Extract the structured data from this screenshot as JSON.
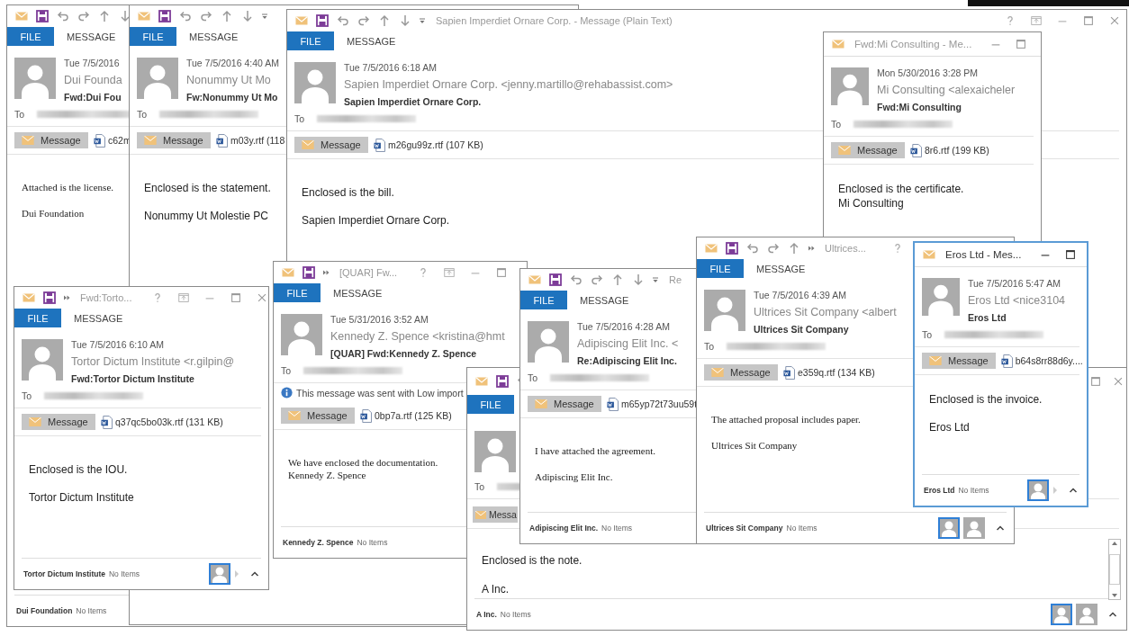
{
  "windows": [
    {
      "kind": "ribbon",
      "active": false,
      "tabs": [
        {
          "label": "FILE",
          "kind": "file"
        },
        {
          "label": "MESSAGE",
          "kind": "tab"
        }
      ],
      "date": "Tue 7/5/2016",
      "sender": "Dui Founda",
      "subject": "Fwd:Dui Fou",
      "to_label": "To",
      "message_button": "Message",
      "attachment": "c62m",
      "body": {
        "kind": "html",
        "paragraphs": [
          [
            "Attached is the license."
          ],
          [
            "Dui Foundation"
          ]
        ]
      },
      "footer": {
        "name": "Dui Foundation",
        "status": "No Items"
      }
    },
    {
      "kind": "ribbon",
      "active": false,
      "tabs": [
        {
          "label": "FILE",
          "kind": "file"
        },
        {
          "label": "MESSAGE",
          "kind": "tab"
        }
      ],
      "date": "Tue 7/5/2016 4:40 AM",
      "sender": "Nonummy Ut Mo",
      "subject": "Fw:Nonummy Ut Mo",
      "to_label": "To",
      "message_button": "Message",
      "attachment": "m03y.rtf (118",
      "body": {
        "kind": "plain",
        "paragraphs": [
          [
            "Enclosed is the statement."
          ],
          [
            "Nonummy Ut Molestie PC"
          ]
        ]
      }
    },
    {
      "kind": "ribbon",
      "active": false,
      "title": "Sapien Imperdiet Ornare Corp. - Message (Plain Text)",
      "tabs": [
        {
          "label": "FILE",
          "kind": "file"
        },
        {
          "label": "MESSAGE",
          "kind": "tab"
        }
      ],
      "date": "Tue 7/5/2016 6:18 AM",
      "sender": "Sapien Imperdiet Ornare Corp. <jenny.martillo@rehabassist.com>",
      "subject": "Sapien Imperdiet Ornare Corp.",
      "to_label": "To",
      "message_button": "Message",
      "attachment": "m26gu99z.rtf (107 KB)",
      "body": {
        "kind": "plain",
        "paragraphs": [
          [
            "Enclosed is the bill."
          ],
          [
            "Sapien Imperdiet Ornare Corp."
          ]
        ]
      }
    },
    {
      "kind": "compact",
      "active": false,
      "title": "Fwd:Mi Consulting - Me...",
      "date": "Mon 5/30/2016 3:28 PM",
      "sender": "Mi Consulting <alexaicheler",
      "subject": "Fwd:Mi Consulting",
      "to_label": "To",
      "message_button": "Message",
      "attachment": "8r6.rtf (199 KB)",
      "body": {
        "kind": "plain",
        "paragraphs": [
          [
            "Enclosed is the certificate.",
            "Mi Consulting"
          ]
        ]
      }
    },
    {
      "kind": "narrow",
      "active": false,
      "title": "Fwd:Torto...",
      "tabs": [
        {
          "label": "FILE",
          "kind": "file"
        },
        {
          "label": "MESSAGE",
          "kind": "tab"
        }
      ],
      "date": "Tue 7/5/2016 6:10 AM",
      "sender": "Tortor Dictum Institute <r.gilpin@",
      "subject": "Fwd:Tortor Dictum Institute",
      "to_label": "To",
      "message_button": "Message",
      "attachment": "q37qc5bo03k.rtf (131 KB)",
      "body": {
        "kind": "plain",
        "paragraphs": [
          [
            "Enclosed is the IOU."
          ],
          [
            "Tortor Dictum Institute"
          ]
        ]
      },
      "footer": {
        "name": "Tortor Dictum Institute",
        "status": "No Items",
        "people": [
          {
            "selected": true
          }
        ]
      }
    },
    {
      "kind": "narrow",
      "active": false,
      "title": "[QUAR] Fw...",
      "tabs": [
        {
          "label": "FILE",
          "kind": "file"
        },
        {
          "label": "MESSAGE",
          "kind": "tab"
        }
      ],
      "date": "Tue 5/31/2016 3:52 AM",
      "sender": "Kennedy Z. Spence <kristina@hmt",
      "subject": "[QUAR] Fwd:Kennedy Z. Spence",
      "to_label": "To",
      "info": "This message was sent with Low import",
      "message_button": "Message",
      "attachment": "0bp7a.rtf (125 KB)",
      "body": {
        "kind": "html",
        "paragraphs": [
          [
            "We have enclosed the documentation.",
            "Kennedy Z. Spence"
          ]
        ]
      },
      "footer": {
        "name": "Kennedy Z. Spence",
        "status": "No Items"
      }
    },
    {
      "kind": "large",
      "active": false,
      "tabs": [
        {
          "label": "FILE",
          "kind": "file"
        }
      ],
      "to_label": "To",
      "message_button": "Messa",
      "body": {
        "kind": "plain",
        "paragraphs": [
          [
            "Enclosed is the note."
          ],
          [
            "A Inc."
          ]
        ]
      },
      "scrollbar": true,
      "footer": {
        "name": "A Inc.",
        "status": "No Items",
        "people": [
          {
            "selected": true
          },
          {
            "selected": false
          }
        ]
      }
    },
    {
      "kind": "ribbon",
      "active": false,
      "title": "Re",
      "tabs": [
        {
          "label": "FILE",
          "kind": "file"
        },
        {
          "label": "MESSAGE",
          "kind": "tab"
        }
      ],
      "date": "Tue 7/5/2016 4:28 AM",
      "sender": "Adipiscing Elit Inc. <",
      "subject": "Re:Adipiscing Elit Inc.",
      "to_label": "To",
      "message_button": "Message",
      "attachment": "m65yp72t73uu59t",
      "body": {
        "kind": "html",
        "paragraphs": [
          [
            "I have attached the agreement."
          ],
          [
            "Adipiscing Elit Inc."
          ]
        ]
      },
      "footer": {
        "name": "Adipiscing Elit Inc.",
        "status": "No Items"
      }
    },
    {
      "kind": "medium",
      "active": false,
      "title": "Ultrices...",
      "tabs": [
        {
          "label": "FILE",
          "kind": "file"
        },
        {
          "label": "MESSAGE",
          "kind": "tab"
        }
      ],
      "date": "Tue 7/5/2016 4:39 AM",
      "sender": "Ultrices Sit Company <albert",
      "subject": "Ultrices Sit Company",
      "to_label": "To",
      "message_button": "Message",
      "attachment": "e359q.rtf (134 KB)",
      "body": {
        "kind": "html",
        "paragraphs": [
          [
            "The attached proposal includes paper."
          ],
          [
            "Ultrices Sit Company"
          ]
        ]
      },
      "footer": {
        "name": "Ultrices Sit Company",
        "status": "No Items",
        "people": [
          {
            "selected": true
          },
          {
            "selected": false
          }
        ]
      }
    },
    {
      "kind": "compact",
      "active": true,
      "title": "Eros Ltd - Mes...",
      "date": "Tue 7/5/2016 5:47 AM",
      "sender": "Eros Ltd <nice3104",
      "subject": "Eros Ltd",
      "to_label": "To",
      "message_button": "Message",
      "attachment": "b64s8rr88d6y....",
      "body": {
        "kind": "plain",
        "paragraphs": [
          [
            "Enclosed is the invoice."
          ],
          [
            "Eros Ltd"
          ]
        ]
      },
      "footer": {
        "name": "Eros Ltd",
        "status": "No Items",
        "people": [
          {
            "selected": true
          }
        ]
      }
    }
  ]
}
